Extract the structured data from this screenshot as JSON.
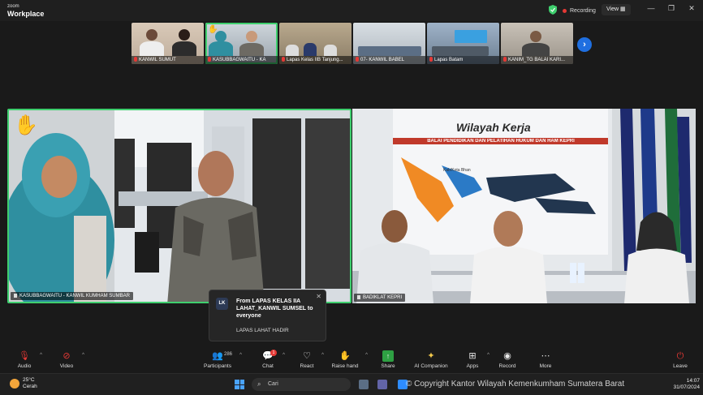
{
  "app": {
    "logo_top": "zoom",
    "logo_bottom": "Workplace",
    "recording": "Recording",
    "view": "View"
  },
  "filmstrip": [
    {
      "name": "KANWIL SUMUT",
      "hand": false
    },
    {
      "name": "KASUBBAGWAITU - KA",
      "hand": true
    },
    {
      "name": "Lapas Kelas IIB Tanjung...",
      "hand": false
    },
    {
      "name": "07- KANWIL BABEL",
      "hand": false
    },
    {
      "name": "Lapas Batam",
      "hand": false
    },
    {
      "name": "KANIM_TG BALAI KARI...",
      "hand": false
    }
  ],
  "videos": {
    "left_label": "KASUBBAGWAITU - KANWIL KUMHAM SUMBAR",
    "right_label": "BADIKLAT KEPRI",
    "banner_title": "Wilayah Kerja",
    "banner_subtitle": "BALAI PENDIDIKAN DAN PELATIHAN HUKUM DAN HAM KEPRI",
    "legend": "Kab/Kota Bhan"
  },
  "toast": {
    "avatar": "LK",
    "title": "From LAPAS KELAS IIA LAHAT_KANWIL SUMSEL to everyone",
    "message": "LAPAS LAHAT HADIR"
  },
  "toolbar": {
    "audio": "Audio",
    "video": "Video",
    "participants": "Participants",
    "participants_count": "286",
    "chat": "Chat",
    "chat_badge": "1",
    "react": "React",
    "raise_hand": "Raise hand",
    "share": "Share",
    "ai": "AI Companion",
    "apps": "Apps",
    "record": "Record",
    "more": "More",
    "leave": "Leave"
  },
  "taskbar": {
    "temp": "25°C",
    "weather": "Cerah",
    "search": "Cari",
    "time": "14:07",
    "date": "31/07/2024"
  },
  "watermark": "© Copyright Kantor Wilayah Kemenkumham Sumatera Barat",
  "colors": {
    "active_border": "#3fcf6e",
    "record_red": "#e53935",
    "accent_blue": "#1f6fe0"
  }
}
